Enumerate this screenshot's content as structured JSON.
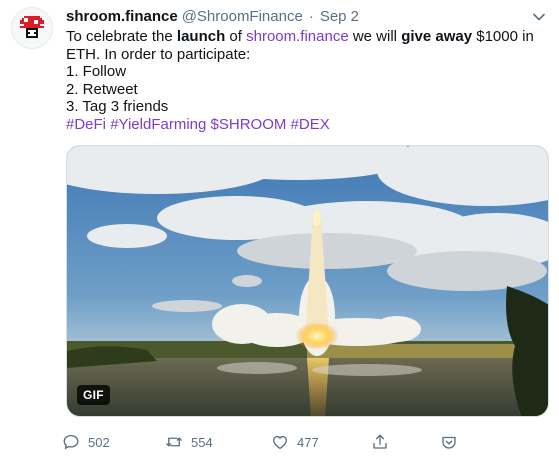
{
  "tweet": {
    "author_name": "shroom.finance",
    "author_handle": "@ShroomFinance",
    "separator": "·",
    "date": "Sep 2",
    "text": {
      "p1_a": "To celebrate the ",
      "p1_b": "launch",
      "p1_c": " of ",
      "p1_link": "shroom.finance",
      "p1_d": " we will ",
      "p1_e": "give away",
      "p1_f": " $1000 in",
      "p2": "ETH. In order to participate:",
      "step1": "1. Follow",
      "step2": "2. Retweet",
      "step3": "3. Tag 3 friends",
      "tags": [
        "#DeFi",
        "#YieldFarming",
        "$SHROOM",
        "#DEX"
      ]
    },
    "media": {
      "badge": "GIF"
    },
    "actions": {
      "replies": "502",
      "retweets": "554",
      "likes": "477"
    }
  },
  "icons": {
    "avatar": "mushroom-logo-icon",
    "menu": "chevron-down-icon",
    "reply": "reply-icon",
    "retweet": "retweet-icon",
    "like": "heart-icon",
    "share": "share-icon",
    "tip": "tip-icon"
  },
  "colors": {
    "link": "#7e3cc8",
    "muted": "#5b7083",
    "text": "#0f1419"
  }
}
